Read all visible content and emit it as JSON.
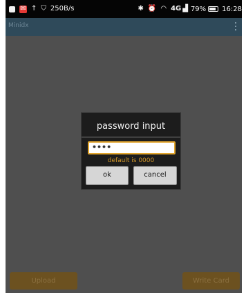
{
  "status_bar": {
    "speed": "250B/s",
    "network": "4G",
    "battery": "79%",
    "time": "16:28",
    "icons": [
      "notification-icon",
      "mail-icon",
      "upload-arrow-icon",
      "shield-icon",
      "bluetooth-icon",
      "alarm-icon",
      "wifi-icon",
      "signal-icon",
      "battery-icon"
    ]
  },
  "app_bar": {
    "title": "Minidx",
    "menu_icon": "overflow-menu-icon"
  },
  "dialog": {
    "title": "password input",
    "password_value": "••••",
    "hint": "default is 0000",
    "ok_label": "ok",
    "cancel_label": "cancel",
    "accent_color": "#e2a52c"
  },
  "bottom_bar": {
    "upload_label": "Upload",
    "write_card_label": "Write Card"
  }
}
